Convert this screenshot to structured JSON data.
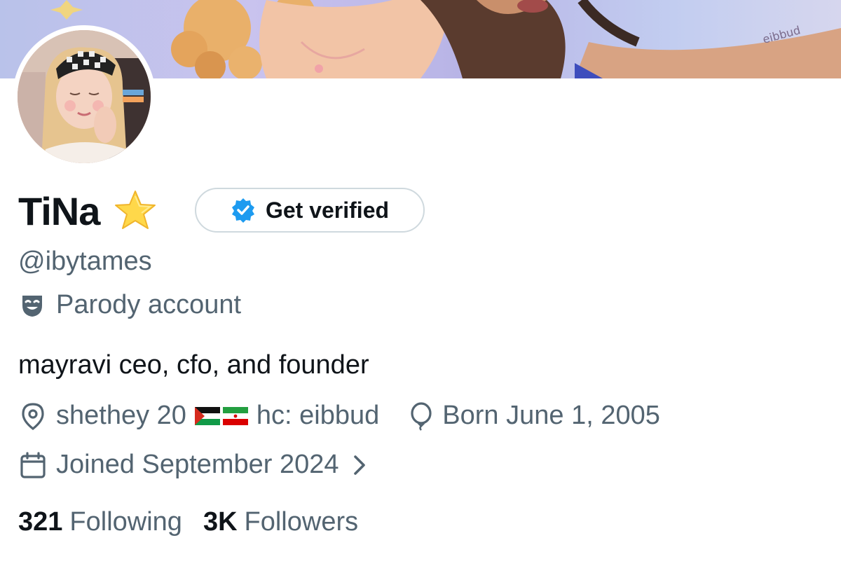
{
  "profile": {
    "display_name": "TiNa",
    "handle": "@ibytames",
    "verify_label": "Get verified",
    "parody_label": "Parody account",
    "bio": "mayravi ceo, cfo, and founder",
    "location": "shethey 20",
    "location_suffix": "hc: eibbud",
    "birthday": "Born June 1, 2005",
    "joined": "Joined September 2024",
    "banner_signature": "eibbud"
  },
  "stats": {
    "following_count": "321",
    "following_label": "Following",
    "followers_count": "3K",
    "followers_label": "Followers"
  },
  "icons": {
    "name_badge": "star-emoji",
    "verify": "verified-check-icon",
    "parody": "theater-mask-icon",
    "location": "map-pin-icon",
    "flags": [
      "palestine-flag",
      "iran-flag"
    ],
    "birthday": "balloon-icon",
    "joined": "calendar-icon",
    "joined_more": "chevron-right-icon"
  },
  "colors": {
    "primary_text": "#0f1419",
    "secondary_text": "#536471",
    "verified_blue": "#1d9bf0",
    "button_border": "#cfd9de"
  }
}
